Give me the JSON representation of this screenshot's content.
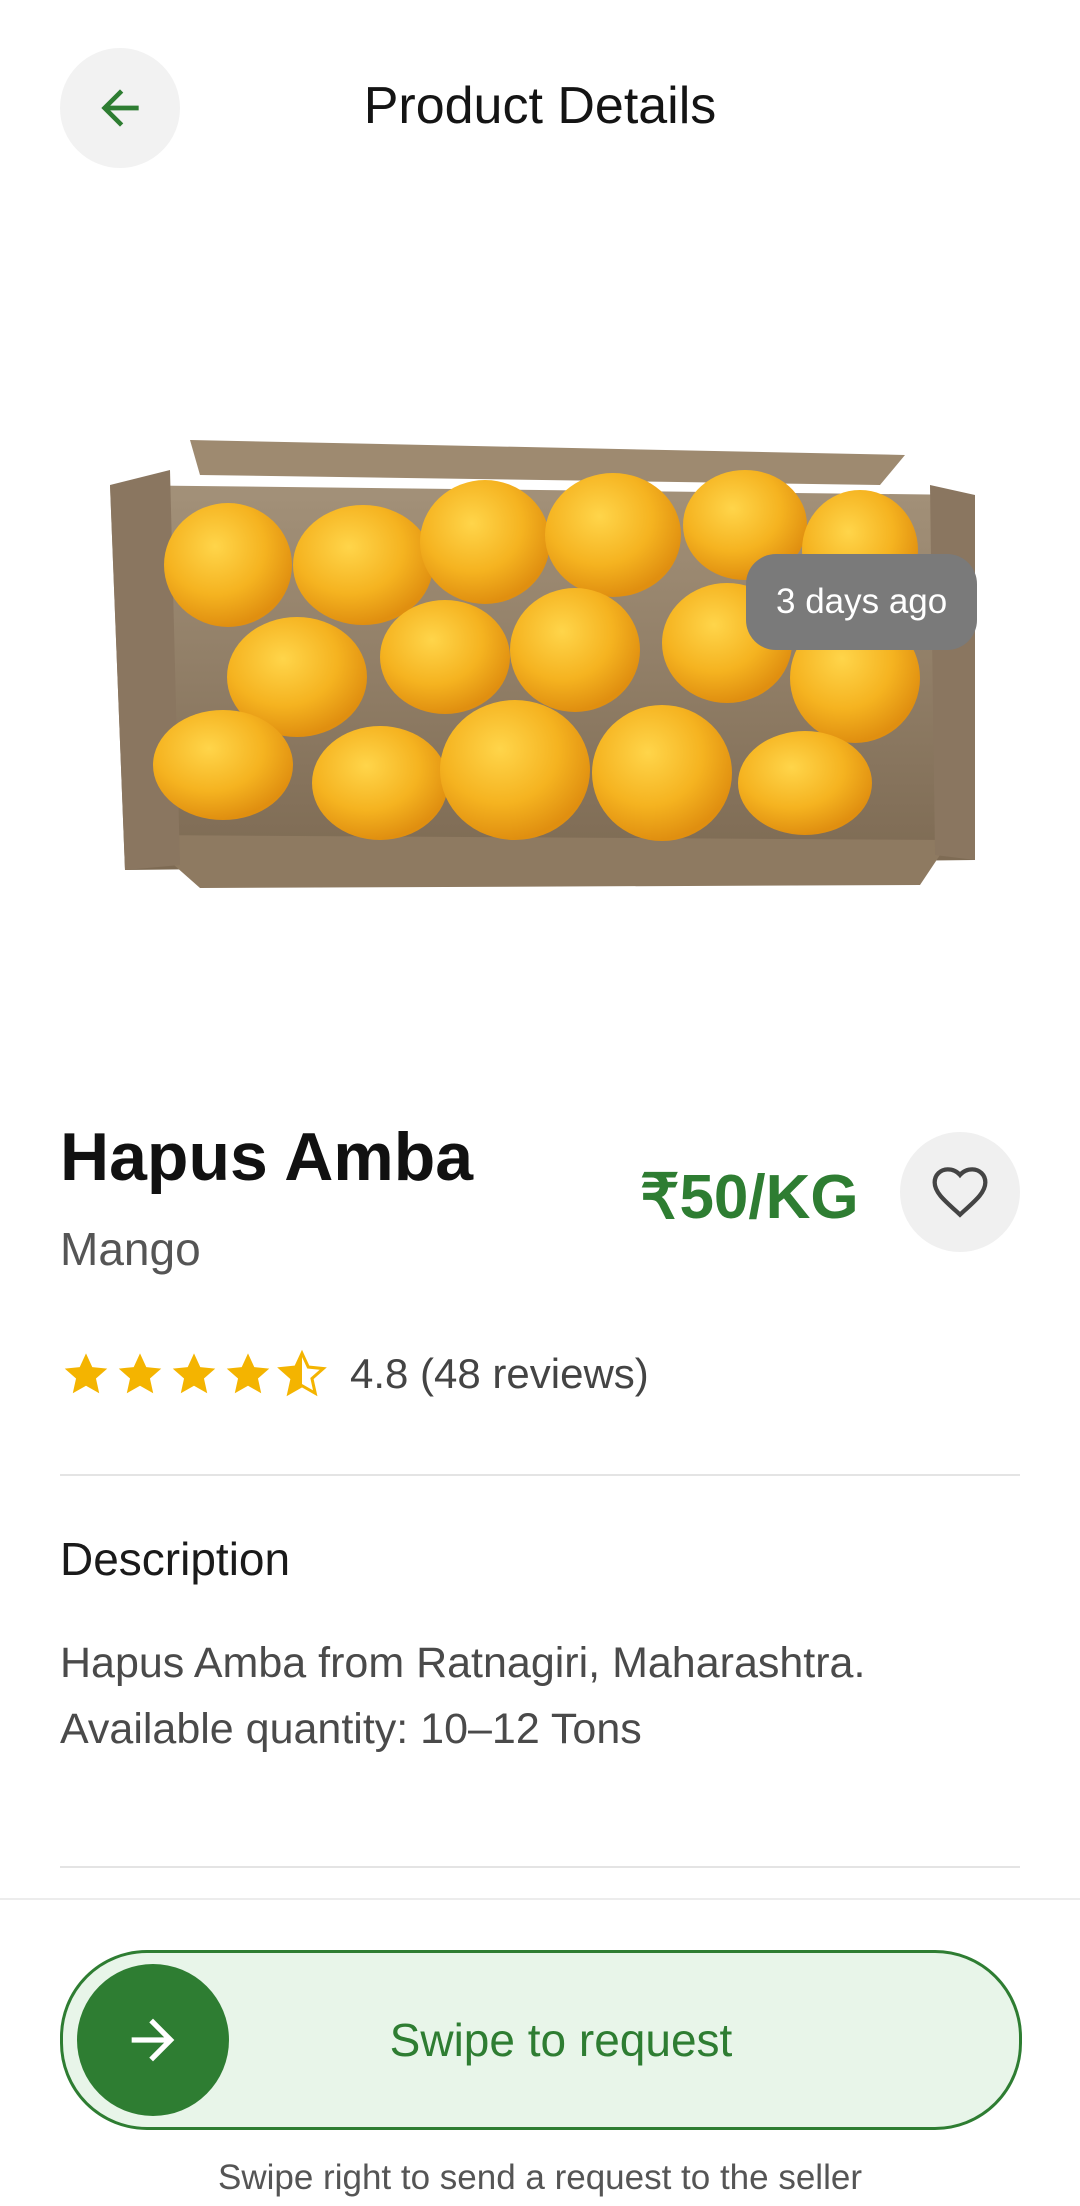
{
  "header": {
    "title": "Product Details",
    "back_icon": "arrow-left-icon"
  },
  "image": {
    "badge": "3 days ago",
    "alt": "crate of mangoes"
  },
  "product": {
    "name": "Hapus Amba",
    "category": "Mango",
    "price": "₹50/KG",
    "rating": 4.8,
    "rating_text": "4.8 (48 reviews)"
  },
  "description": {
    "title": "Description",
    "lines": [
      "Hapus Amba from Ratnagiri, Maharashtra.",
      "Available quantity: 10–12 Tons"
    ]
  },
  "swipe": {
    "label": "Swipe to request",
    "hint": "Swipe right to send a request to the seller"
  },
  "colors": {
    "accent": "#2e7d32",
    "track": "#e8f5e9",
    "star": "#f4b400",
    "badge": "#7a7a7a"
  }
}
